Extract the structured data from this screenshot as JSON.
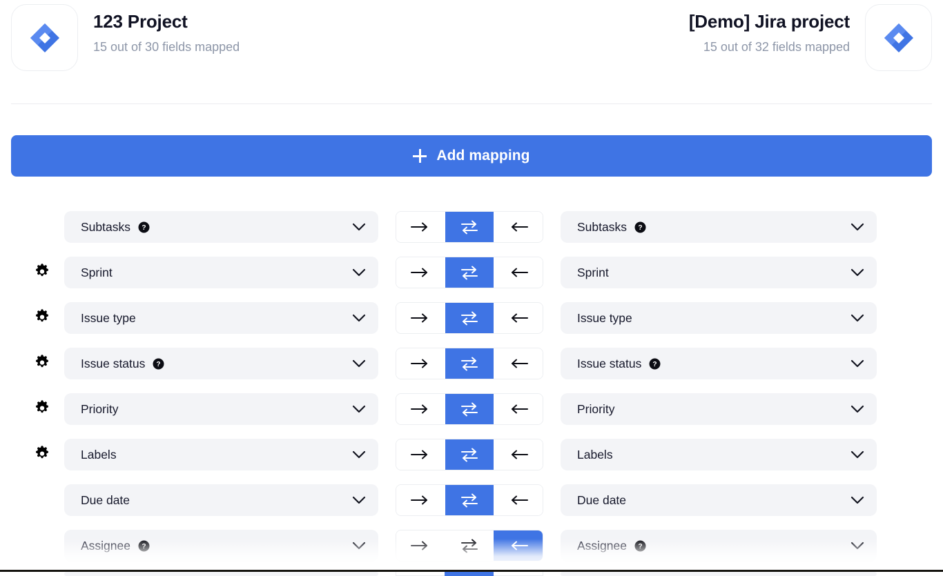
{
  "colors": {
    "accent": "#3f74e4",
    "pill_bg": "#f3f4f7",
    "text": "#16182b",
    "muted": "#8d96a8",
    "divider": "#ebecf0"
  },
  "header": {
    "left_project": {
      "logo": "jira-logo-icon",
      "title": "123 Project",
      "subtitle": "15 out of 30 fields mapped"
    },
    "right_project": {
      "logo": "jira-logo-icon",
      "title": "[Demo] Jira project",
      "subtitle": "15 out of 32 fields mapped"
    }
  },
  "toolbar": {
    "add_mapping_label": "Add mapping",
    "add_mapping_icon": "plus-icon"
  },
  "direction_options": [
    {
      "id": "right",
      "icon": "arrow-right-icon",
      "glyph": "→"
    },
    {
      "id": "both",
      "icon": "bidirectional-arrows-icon",
      "glyph": "⇄"
    },
    {
      "id": "left",
      "icon": "arrow-left-icon",
      "glyph": "←"
    }
  ],
  "mappings": [
    {
      "gear": false,
      "direction": "both",
      "left": {
        "label": "Subtasks",
        "help": true
      },
      "right": {
        "label": "Subtasks",
        "help": true
      }
    },
    {
      "gear": true,
      "direction": "both",
      "left": {
        "label": "Sprint",
        "help": false
      },
      "right": {
        "label": "Sprint",
        "help": false
      }
    },
    {
      "gear": true,
      "direction": "both",
      "left": {
        "label": "Issue type",
        "help": false
      },
      "right": {
        "label": "Issue type",
        "help": false
      }
    },
    {
      "gear": true,
      "direction": "both",
      "left": {
        "label": "Issue status",
        "help": true
      },
      "right": {
        "label": "Issue status",
        "help": true
      }
    },
    {
      "gear": true,
      "direction": "both",
      "left": {
        "label": "Priority",
        "help": false
      },
      "right": {
        "label": "Priority",
        "help": false
      }
    },
    {
      "gear": true,
      "direction": "both",
      "left": {
        "label": "Labels",
        "help": false
      },
      "right": {
        "label": "Labels",
        "help": false
      }
    },
    {
      "gear": false,
      "direction": "both",
      "left": {
        "label": "Due date",
        "help": false
      },
      "right": {
        "label": "Due date",
        "help": false
      }
    },
    {
      "gear": false,
      "direction": "left",
      "left": {
        "label": "Assignee",
        "help": true
      },
      "right": {
        "label": "Assignee",
        "help": true
      }
    }
  ]
}
